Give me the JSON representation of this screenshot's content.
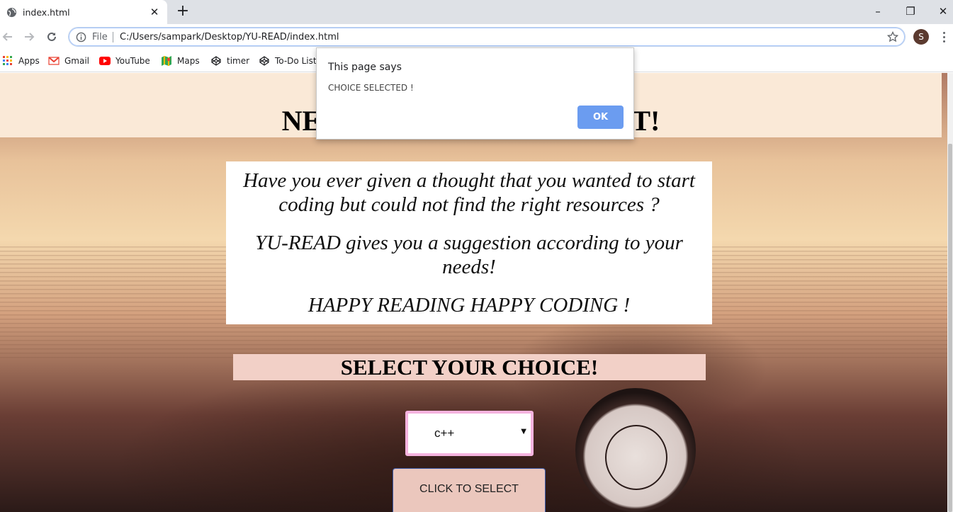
{
  "browser": {
    "tab": {
      "title": "index.html",
      "close_glyph": "✕",
      "favicon": "globe-icon"
    },
    "new_tab_glyph": "+",
    "window_controls": {
      "minimize": "–",
      "maximize": "❐",
      "close": "✕"
    },
    "omnibox": {
      "scheme_label": "File",
      "url": "C:/Users/sampark/Desktop/YU-READ/index.html"
    },
    "profile_initial": "S",
    "bookmarks": [
      {
        "label": "Apps",
        "icon": "apps-grid-icon"
      },
      {
        "label": "Gmail",
        "icon": "gmail-icon"
      },
      {
        "label": "YouTube",
        "icon": "youtube-icon"
      },
      {
        "label": "Maps",
        "icon": "maps-icon"
      },
      {
        "label": "timer",
        "icon": "codepen-icon"
      },
      {
        "label": "To-Do List",
        "icon": "codepen-icon"
      }
    ]
  },
  "page": {
    "heading": "NEW                                     NT!",
    "intro": [
      "Have you ever given a thought that you wanted to start coding but could not find the right resources ?",
      "YU-READ gives you a suggestion according to your needs!",
      "HAPPY READING HAPPY CODING !"
    ],
    "select_title": "SELECT YOUR CHOICE!",
    "choice": {
      "selected": "c++",
      "arrow": "▼"
    },
    "select_button": "CLICK TO SELECT"
  },
  "dialog": {
    "title": "This page says",
    "message": "CHOICE SELECTED !",
    "ok_label": "OK"
  },
  "colors": {
    "header_band": "#fae9d7",
    "select_title_bg": "#f2d0c7",
    "choice_border": "#f5b3df",
    "button_bg": "#ebc7bd",
    "dialog_ok": "#6b9cf0"
  }
}
